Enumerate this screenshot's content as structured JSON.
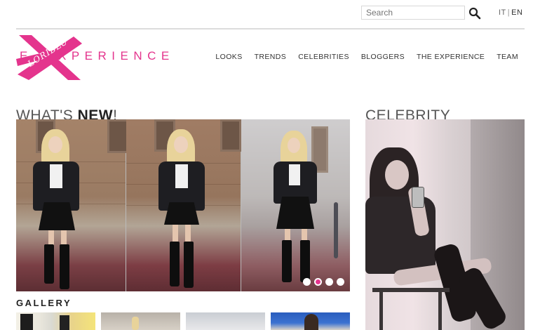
{
  "search": {
    "placeholder": "Search"
  },
  "language": {
    "it": "IT",
    "separator": "|",
    "en": "EN",
    "active": "EN"
  },
  "logo": {
    "initial": "E",
    "word": "XPERIENCE",
    "script": "LORIBLU"
  },
  "nav": {
    "items": [
      {
        "label": "LOOKS"
      },
      {
        "label": "TRENDS"
      },
      {
        "label": "CELEBRITIES"
      },
      {
        "label": "BLOGGERS"
      },
      {
        "label": "THE EXPERIENCE"
      },
      {
        "label": "TEAM"
      }
    ]
  },
  "whats_new": {
    "prefix": "WHAT'S ",
    "emphasis": "NEW",
    "suffix": "!"
  },
  "celebrity": {
    "title": "CELEBRITY"
  },
  "slider": {
    "dot_count": 4,
    "active_dot": 2
  },
  "gallery": {
    "title": "GALLERY"
  },
  "colors": {
    "accent": "#e4348d",
    "rule": "#dcdcdc",
    "text": "#333333"
  }
}
